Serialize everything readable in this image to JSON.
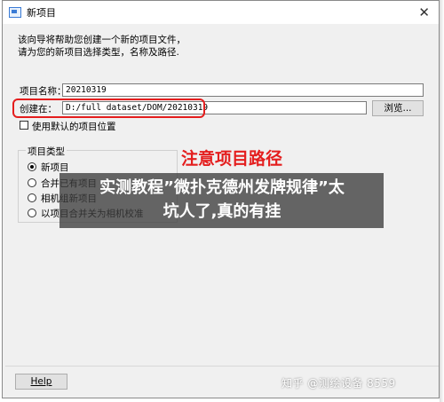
{
  "window": {
    "title": "新项目",
    "close_glyph": "✕"
  },
  "intro": {
    "line1": "该向导将帮助您创建一个新的项目文件，",
    "line2": "请为您的新项目选择类型，名称及路径."
  },
  "project_name": {
    "label": "项目名称：",
    "value": "20210319"
  },
  "create_in": {
    "label": "创建在：",
    "value": "D:/full dataset/DOM/20210319",
    "browse_label": "浏览..."
  },
  "use_default_location": {
    "label": "使用默认的项目位置",
    "checked": false
  },
  "project_type": {
    "group_label": "项目类型",
    "options": [
      {
        "label": "新项目",
        "selected": true
      },
      {
        "label": "合并已有项目",
        "selected": false
      },
      {
        "label": "相机组新项目",
        "selected": false
      },
      {
        "label": "以项目合并关为相机校准",
        "selected": false
      }
    ]
  },
  "annotation": {
    "text": "注意项目路径",
    "color": "#e41e1e"
  },
  "overlay_banner": {
    "line1": "实测教程”微扑克德州发牌规律”太",
    "line2": "坑人了,真的有挂"
  },
  "footer": {
    "help_label": "Help",
    "watermark": "知乎 @测绘设备 8559"
  }
}
